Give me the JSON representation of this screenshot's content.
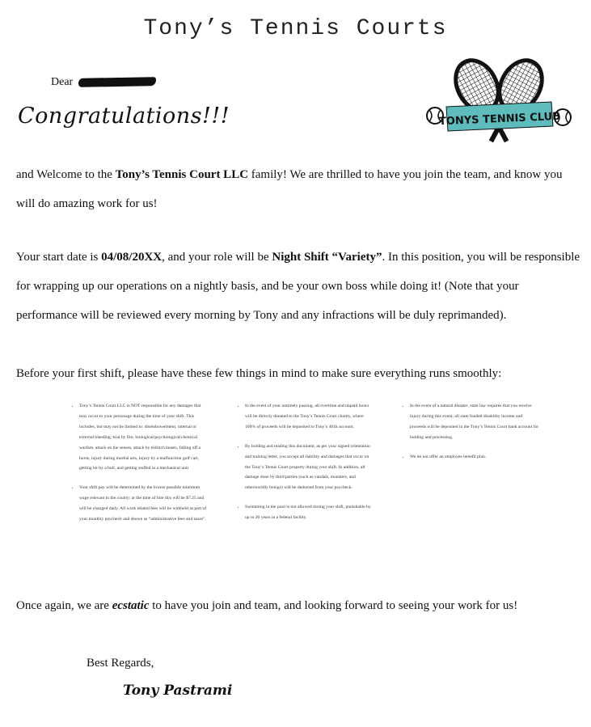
{
  "header": {
    "title": "Tony’s Tennis Courts"
  },
  "greeting": {
    "dear": "Dear",
    "congrats": "Congratulations!!!"
  },
  "logo": {
    "text": "TONYS TENNIS CLUB",
    "icon": "crossed-rackets-logo",
    "accent_color": "#5fbcbc"
  },
  "para1": {
    "a": "and Welcome to the ",
    "b": "Tony’s Tennis Court LLC",
    "c": " family! We are thrilled to have you join the team, and know you will do amazing work for us!"
  },
  "para2": {
    "a": "Your start date is ",
    "b": "04/08/20XX",
    "c": ", and your role will be ",
    "d": "Night Shift “Variety”",
    "e": ". In this position, you will be responsible for wrapping up our operations on a nightly basis, and be your own boss while doing it! (Note that your performance will be reviewed every morning by Tony and any infractions will be duly reprimanded)."
  },
  "para3": "Before your first shift, please have these few things in mind to make sure everything runs smoothly:",
  "rules": {
    "col1": [
      "Tony’s Tennis Court LLC is NOT responsible for any damages that may occur to your personage during the time of your shift. This includes, but may not be limited to: disembowelment, internal or external bleeding, trial by fire, biological/psychological/chemical warfare, attack on the senses, attack by eldritch beasts, falling off a horse, injury during martial arts, injury by a malfunction golf cart, getting hit by a bull, and getting stuffed in a mechanical unit",
      "Your shift pay will be determined by the lowest possible minimum wage relevant in the county: at the time of hire this will be $7.25 and will be changed daily. All work related fees will be withheld as part of your monthly paycheck and shown as “administrative fees and taxes”."
    ],
    "col2": [
      "In the event of your untimely passing, all overtime and unpaid hours will be directly donated to the Tony’s Tennis Court charity, where 100% of proceeds will be deposited to Tony’s 401k account.",
      "By holding and reading this document, as per your signed orientation and training letter, you accept all liability and damages that occur on the Tony’s Tennis Court property during your shift. In addition, all damage done by third parties (such as vandals, monsters, and otherworldly beings) will be deducted from your paycheck.",
      "Swimming in the pool is not allowed during your shift, punishable by up to 20 years in a federal facility."
    ],
    "col3": [
      "In the event of a natural disaster, state law requires that you receive injury during this event; all state funded disability income and proceeds will be deposited in the Tony’s Tennis Court bank account for holding and processing.",
      "We do not offer an employee benefit plan."
    ]
  },
  "para4": {
    "a": "Once again, we are ",
    "b": "ecstatic",
    "c": " to have you join and team, and looking forward to seeing your work for us!"
  },
  "closing": {
    "regards": "Best Regards,",
    "signature": "Tony Pastrami"
  }
}
